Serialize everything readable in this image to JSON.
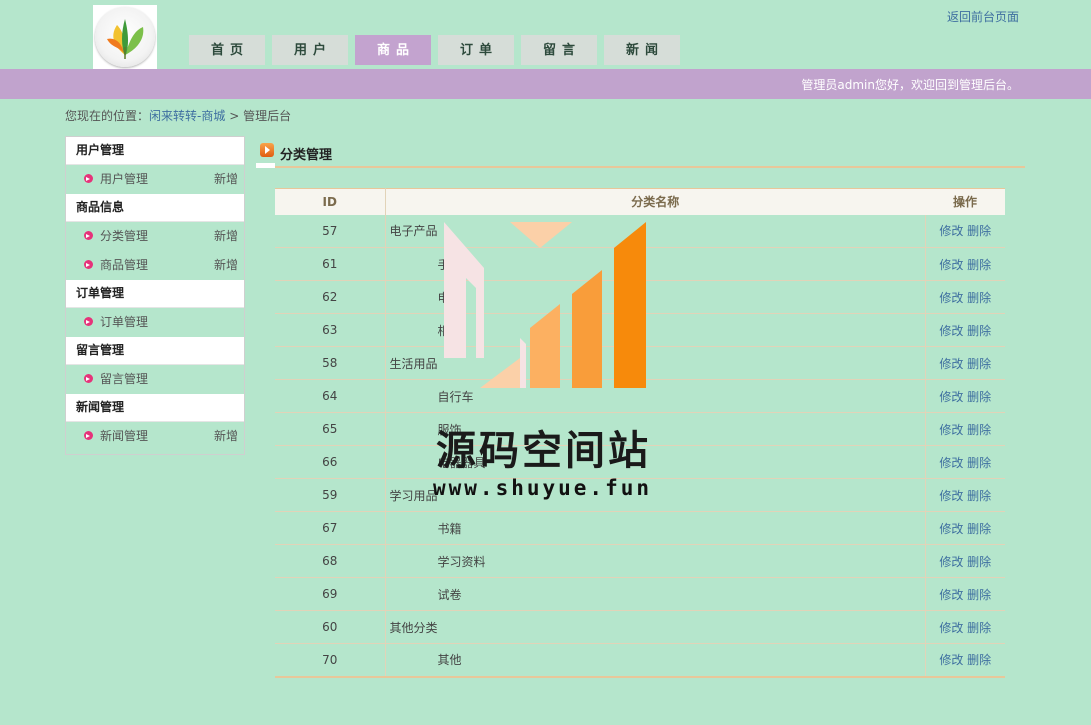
{
  "header": {
    "logo_icon": "leaf-logo-icon",
    "nav": [
      {
        "label": "首页",
        "active": false
      },
      {
        "label": "用户",
        "active": false
      },
      {
        "label": "商品",
        "active": true
      },
      {
        "label": "订单",
        "active": false
      },
      {
        "label": "留言",
        "active": false
      },
      {
        "label": "新闻",
        "active": false
      }
    ],
    "back_link": "返回前台页面",
    "welcome": "管理员admin您好，欢迎回到管理后台。"
  },
  "breadcrumb": {
    "prefix": "您现在的位置：",
    "link": "闲来转转-商城",
    "separator": ">",
    "current": "管理后台"
  },
  "sidebar": {
    "groups": [
      {
        "title": "用户管理",
        "items": [
          {
            "label": "用户管理",
            "add": "新增"
          }
        ]
      },
      {
        "title": "商品信息",
        "items": [
          {
            "label": "分类管理",
            "add": "新增"
          },
          {
            "label": "商品管理",
            "add": "新增"
          }
        ]
      },
      {
        "title": "订单管理",
        "items": [
          {
            "label": "订单管理",
            "add": ""
          }
        ]
      },
      {
        "title": "留言管理",
        "items": [
          {
            "label": "留言管理",
            "add": ""
          }
        ]
      },
      {
        "title": "新闻管理",
        "items": [
          {
            "label": "新闻管理",
            "add": "新增"
          }
        ]
      }
    ]
  },
  "main": {
    "title": "分类管理",
    "columns": {
      "id": "ID",
      "name": "分类名称",
      "op": "操作"
    },
    "edit_label": "修改",
    "delete_label": "删除",
    "rows": [
      {
        "id": "57",
        "name": "电子产品",
        "child": false
      },
      {
        "id": "61",
        "name": "手机",
        "child": true
      },
      {
        "id": "62",
        "name": "电脑",
        "child": true
      },
      {
        "id": "63",
        "name": "相机",
        "child": true
      },
      {
        "id": "58",
        "name": "生活用品",
        "child": false
      },
      {
        "id": "64",
        "name": "自行车",
        "child": true
      },
      {
        "id": "65",
        "name": "服饰",
        "child": true
      },
      {
        "id": "66",
        "name": "电器器具",
        "child": true
      },
      {
        "id": "59",
        "name": "学习用品",
        "child": false
      },
      {
        "id": "67",
        "name": "书籍",
        "child": true
      },
      {
        "id": "68",
        "name": "学习资料",
        "child": true
      },
      {
        "id": "69",
        "name": "试卷",
        "child": true
      },
      {
        "id": "60",
        "name": "其他分类",
        "child": false
      },
      {
        "id": "70",
        "name": "其他",
        "child": true
      }
    ]
  },
  "watermark": {
    "text": "源码空间站",
    "url": "www.shuyue.fun",
    "colors": {
      "pink": "#f6e3e4",
      "peach": "#fbd0a8",
      "orange1": "#fcb061",
      "orange2": "#f99d3a",
      "orange3": "#f78a0b"
    }
  }
}
